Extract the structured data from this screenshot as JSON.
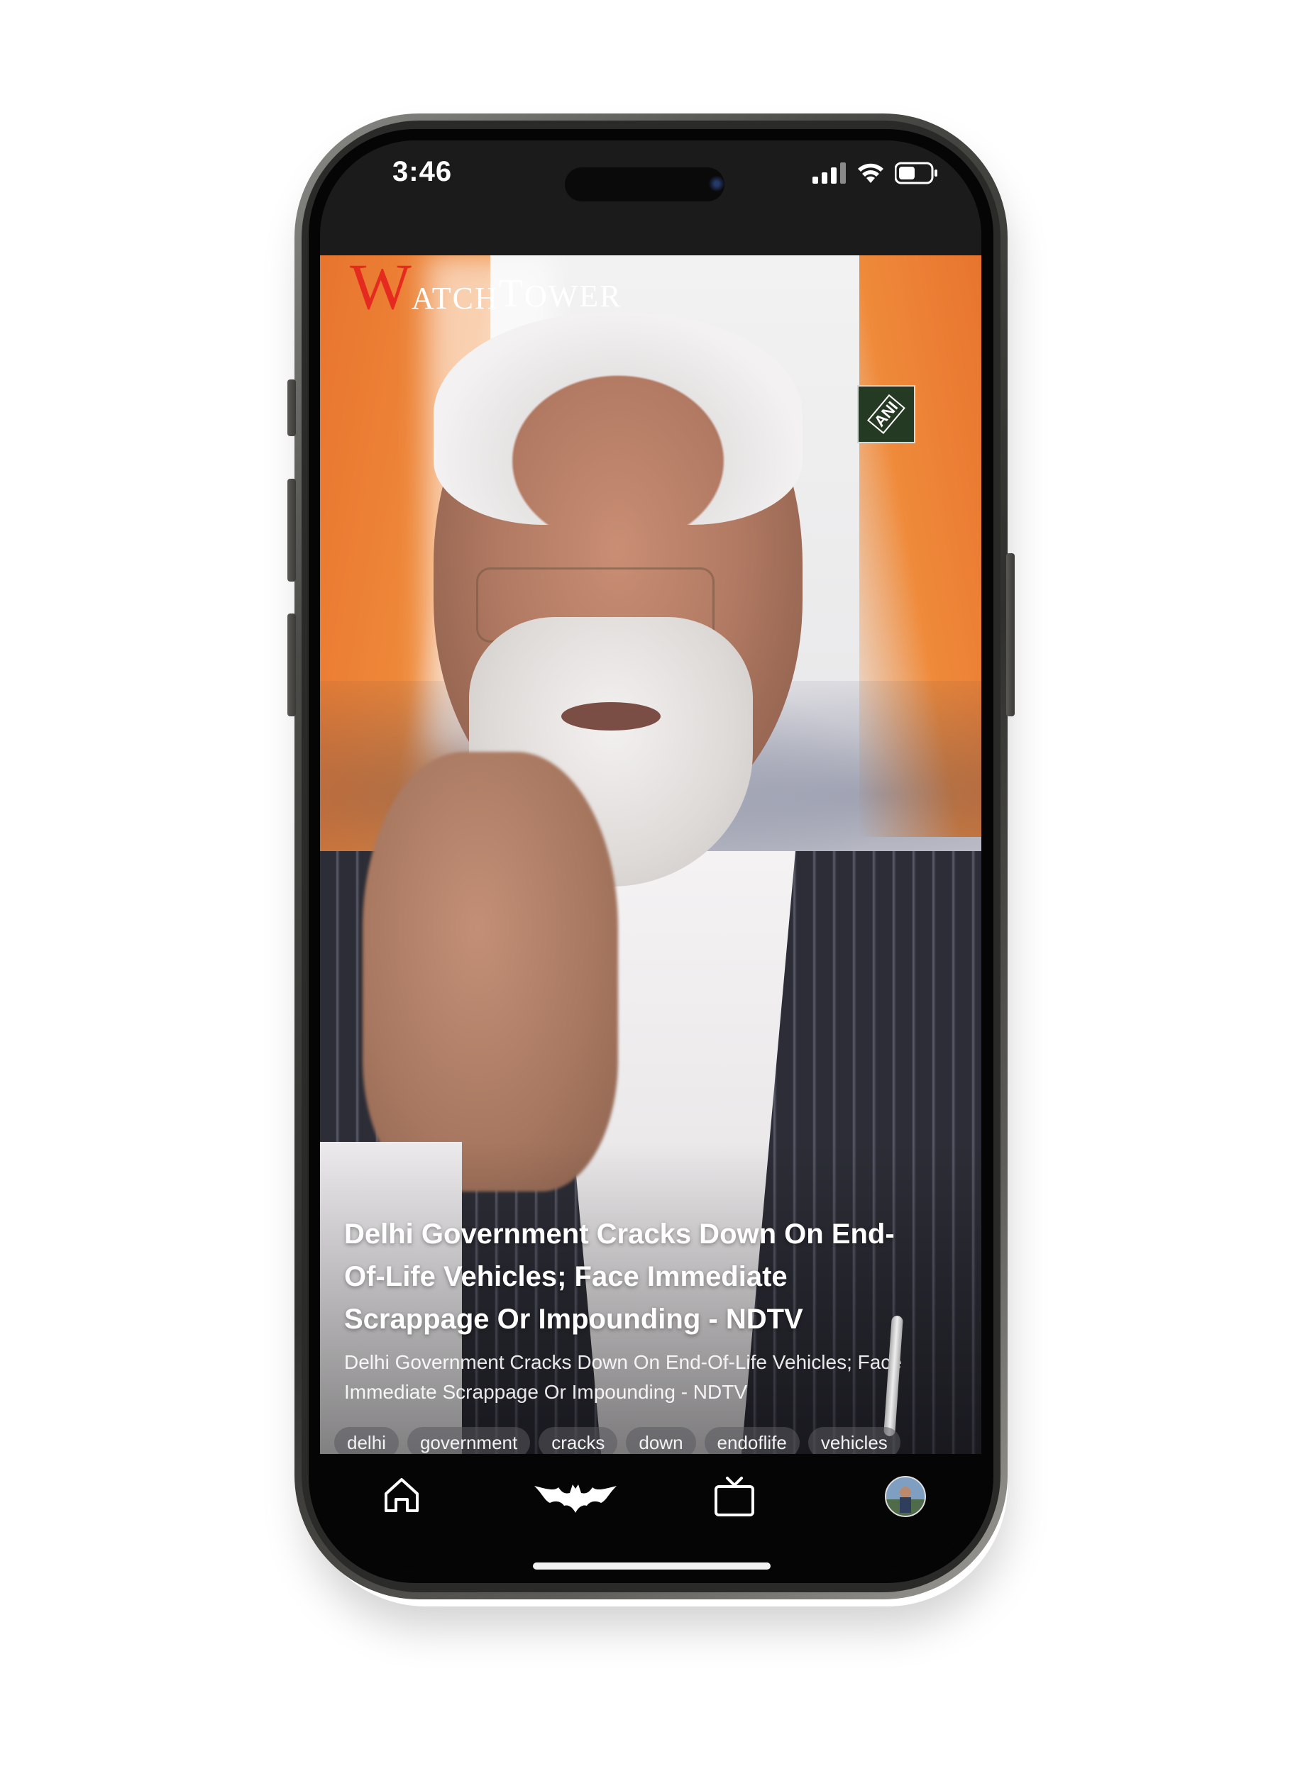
{
  "status_bar": {
    "time": "3:46",
    "signal_icon": "cellular-signal-icon",
    "wifi_icon": "wifi-icon",
    "battery_icon": "battery-icon"
  },
  "brand": {
    "logo_initial": "W",
    "logo_rest_1": "atch",
    "logo_initial_2": "T",
    "logo_rest_2": "ower",
    "accent_color": "#e52b1f"
  },
  "video": {
    "source_badge": "ANI",
    "headline": "Delhi Government Cracks Down On End-Of-Life Vehicles; Face Immediate Scrappage Or Impounding - NDTV",
    "description": "Delhi Government Cracks Down On End-Of-Life Vehicles; Face Immediate Scrappage Or Impounding - NDTV",
    "tags": [
      "delhi",
      "government",
      "cracks",
      "down",
      "endoflife",
      "vehicles"
    ]
  },
  "bottom_nav": {
    "items": [
      {
        "icon": "home-icon"
      },
      {
        "icon": "bat-logo-icon"
      },
      {
        "icon": "tv-icon"
      },
      {
        "icon": "profile-avatar-icon"
      }
    ]
  }
}
